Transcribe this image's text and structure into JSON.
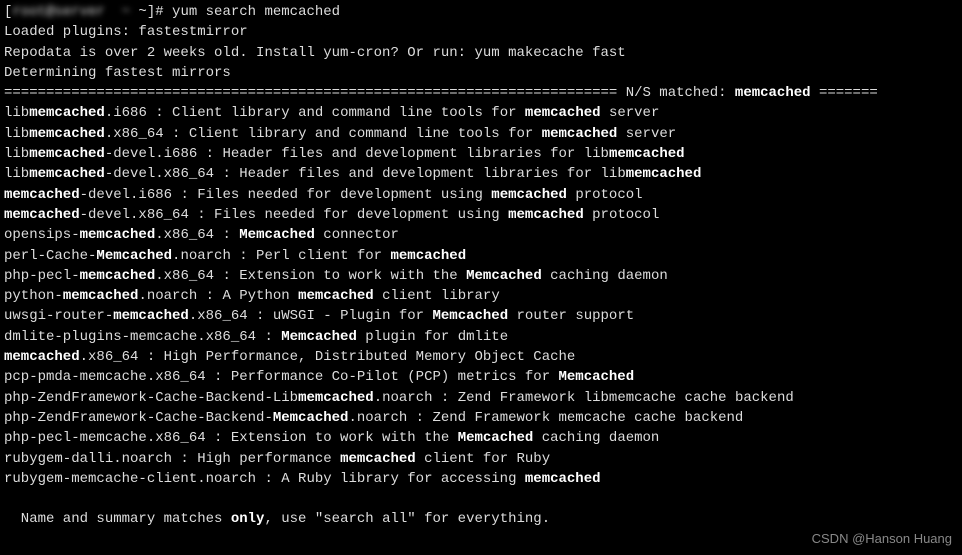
{
  "prompt": {
    "host_blurred": "root@server  ~",
    "suffix": " ~]# ",
    "command": "yum search memcached"
  },
  "loaded_plugins": "Loaded plugins: fastestmirror",
  "repodata_msg": "Repodata is over 2 weeks old. Install yum-cron? Or run: yum makecache fast",
  "determining_msg": "Determining fastest mirrors",
  "section_header": {
    "left": "========================================================================= N/S matched: ",
    "term": "memcached",
    "right": " ======="
  },
  "results": [
    {
      "prefix": "lib",
      "match": "memcached",
      "suffix1": ".i686 : Client library and command line tools for ",
      "match2": "memcached",
      "suffix2": " server"
    },
    {
      "prefix": "lib",
      "match": "memcached",
      "suffix1": ".x86_64 : Client library and command line tools for ",
      "match2": "memcached",
      "suffix2": " server"
    },
    {
      "prefix": "lib",
      "match": "memcached",
      "suffix1": "-devel.i686 : Header files and development libraries for lib",
      "match2": "memcached",
      "suffix2": ""
    },
    {
      "prefix": "lib",
      "match": "memcached",
      "suffix1": "-devel.x86_64 : Header files and development libraries for lib",
      "match2": "memcached",
      "suffix2": ""
    },
    {
      "prefix": "",
      "match": "memcached",
      "suffix1": "-devel.i686 : Files needed for development using ",
      "match2": "memcached",
      "suffix2": " protocol"
    },
    {
      "prefix": "",
      "match": "memcached",
      "suffix1": "-devel.x86_64 : Files needed for development using ",
      "match2": "memcached",
      "suffix2": " protocol"
    },
    {
      "prefix": "opensips-",
      "match": "memcached",
      "suffix1": ".x86_64 : ",
      "match2": "Memcached",
      "suffix2": " connector"
    },
    {
      "prefix": "perl-Cache-",
      "match": "Memcached",
      "suffix1": ".noarch : Perl client for ",
      "match2": "memcached",
      "suffix2": ""
    },
    {
      "prefix": "php-pecl-",
      "match": "memcached",
      "suffix1": ".x86_64 : Extension to work with the ",
      "match2": "Memcached",
      "suffix2": " caching daemon"
    },
    {
      "prefix": "python-",
      "match": "memcached",
      "suffix1": ".noarch : A Python ",
      "match2": "memcached",
      "suffix2": " client library"
    },
    {
      "prefix": "uwsgi-router-",
      "match": "memcached",
      "suffix1": ".x86_64 : uWSGI - Plugin for ",
      "match2": "Memcached",
      "suffix2": " router support"
    },
    {
      "prefix": "dmlite-plugins-memcache.x86_64 : ",
      "match": "Memcached",
      "suffix1": " plugin for dmlite",
      "match2": "",
      "suffix2": ""
    },
    {
      "prefix": "",
      "match": "memcached",
      "suffix1": ".x86_64 : High Performance, Distributed Memory Object Cache",
      "match2": "",
      "suffix2": ""
    },
    {
      "prefix": "pcp-pmda-memcache.x86_64 : Performance Co-Pilot (PCP) metrics for ",
      "match": "Memcached",
      "suffix1": "",
      "match2": "",
      "suffix2": ""
    },
    {
      "prefix": "php-ZendFramework-Cache-Backend-Lib",
      "match": "memcached",
      "suffix1": ".noarch : Zend Framework libmemcache cache backend",
      "match2": "",
      "suffix2": ""
    },
    {
      "prefix": "php-ZendFramework-Cache-Backend-",
      "match": "Memcached",
      "suffix1": ".noarch : Zend Framework memcache cache backend",
      "match2": "",
      "suffix2": ""
    },
    {
      "prefix": "php-pecl-memcache.x86_64 : Extension to work with the ",
      "match": "Memcached",
      "suffix1": " caching daemon",
      "match2": "",
      "suffix2": ""
    },
    {
      "prefix": "rubygem-dalli.noarch : High performance ",
      "match": "memcached",
      "suffix1": " client for Ruby",
      "match2": "",
      "suffix2": ""
    },
    {
      "prefix": "rubygem-memcache-client.noarch : A Ruby library for accessing ",
      "match": "memcached",
      "suffix1": "",
      "match2": "",
      "suffix2": ""
    }
  ],
  "footer": {
    "pre": "  Name and summary matches ",
    "only": "only",
    "post": ", use \"search all\" for everything."
  },
  "watermark": "CSDN @Hanson Huang"
}
